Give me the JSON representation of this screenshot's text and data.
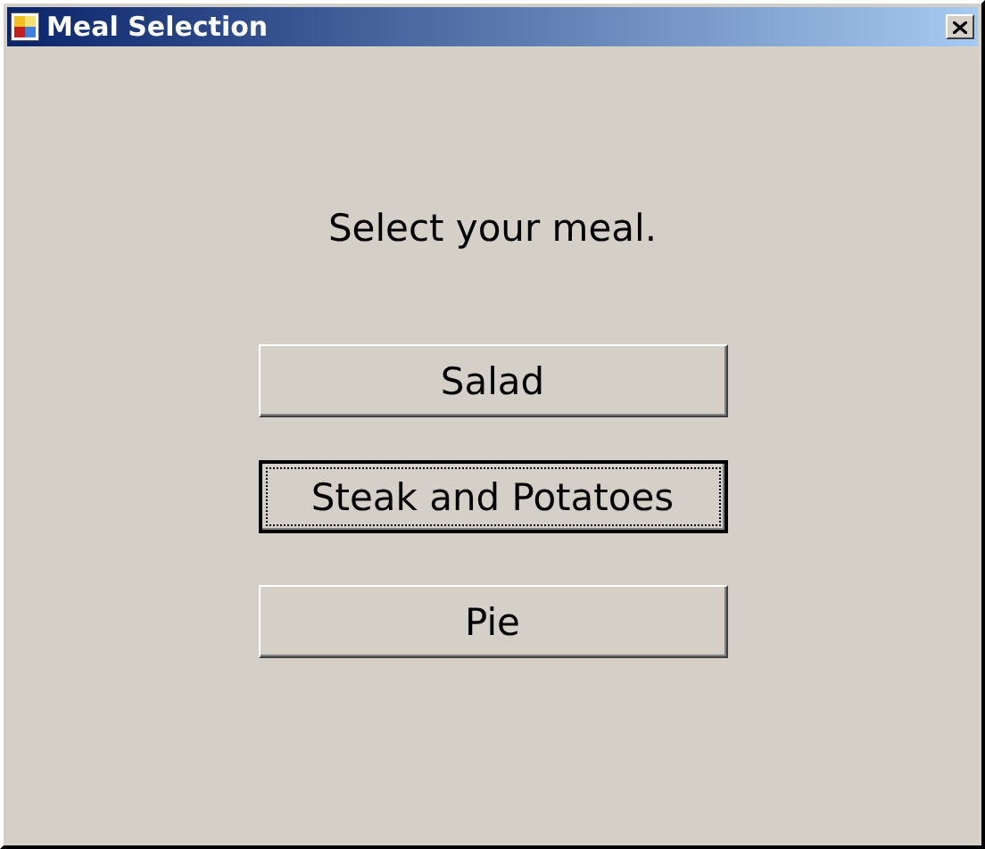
{
  "window": {
    "title": "Meal Selection"
  },
  "prompt": "Select your meal.",
  "buttons": [
    {
      "label": "Salad",
      "focused": false
    },
    {
      "label": "Steak and Potatoes",
      "focused": true
    },
    {
      "label": "Pie",
      "focused": false
    }
  ]
}
